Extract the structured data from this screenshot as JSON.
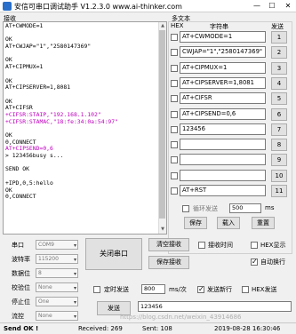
{
  "window": {
    "title": "安信可串口调试助手 V1.2.3.0    www.ai-thinker.com",
    "minimize": "—",
    "maximize": "☐",
    "close": "✕"
  },
  "receive": {
    "label": "接收",
    "lines": [
      {
        "text": "AT+CWMODE=1",
        "style": ""
      },
      {
        "text": "",
        "style": ""
      },
      {
        "text": "OK",
        "style": ""
      },
      {
        "text": "AT+CWJAP=\"1\",\"2580147369\"",
        "style": ""
      },
      {
        "text": "",
        "style": ""
      },
      {
        "text": "OK",
        "style": ""
      },
      {
        "text": "AT+CIPMUX=1",
        "style": ""
      },
      {
        "text": "",
        "style": ""
      },
      {
        "text": "OK",
        "style": ""
      },
      {
        "text": "AT+CIPSERVER=1,8081",
        "style": ""
      },
      {
        "text": "",
        "style": ""
      },
      {
        "text": "OK",
        "style": ""
      },
      {
        "text": "AT+CIFSR",
        "style": ""
      },
      {
        "text": "+CIFSR:STAIP,\"192.168.1.102\"",
        "style": "pink"
      },
      {
        "text": "+CIFSR:STAMAC,\"18:fe:34:0a:54:97\"",
        "style": "pink"
      },
      {
        "text": "",
        "style": ""
      },
      {
        "text": "OK",
        "style": ""
      },
      {
        "text": "0,CONNECT",
        "style": ""
      },
      {
        "text": "AT+CIPSEND=0,6",
        "style": "pink"
      },
      {
        "text": "> 123456busy s...",
        "style": ""
      },
      {
        "text": "",
        "style": ""
      },
      {
        "text": "SEND OK",
        "style": ""
      },
      {
        "text": "",
        "style": ""
      },
      {
        "text": "+IPD,0,5:hello",
        "style": ""
      },
      {
        "text": "OK",
        "style": ""
      },
      {
        "text": "0,CONNECT",
        "style": ""
      }
    ]
  },
  "multi": {
    "label": "多文本",
    "hex_header": "HEX",
    "string_header": "字符串",
    "send_header": "发送",
    "rows": [
      {
        "checked": false,
        "text": "AT+CWMODE=1",
        "btn": "1"
      },
      {
        "checked": false,
        "text": "CWJAP=\"1\",\"2580147369\"",
        "btn": "2"
      },
      {
        "checked": false,
        "text": "AT+CIPMUX=1",
        "btn": "3"
      },
      {
        "checked": false,
        "text": "AT+CIPSERVER=1,8081",
        "btn": "4"
      },
      {
        "checked": false,
        "text": "AT+CIFSR",
        "btn": "5"
      },
      {
        "checked": false,
        "text": "AT+CIPSEND=0,6",
        "btn": "6"
      },
      {
        "checked": false,
        "text": "123456",
        "btn": "7"
      },
      {
        "checked": false,
        "text": "",
        "btn": "8"
      },
      {
        "checked": false,
        "text": "",
        "btn": "9"
      },
      {
        "checked": false,
        "text": "",
        "btn": "10"
      },
      {
        "checked": false,
        "text": "AT+RST",
        "btn": "11"
      }
    ],
    "loop_label": "循环发送",
    "loop_value": "500",
    "loop_unit": "ms",
    "save_btn": "保存",
    "load_btn": "载入",
    "reset_btn": "重置"
  },
  "serial": {
    "port_label": "串口",
    "port_value": "COM9",
    "baud_label": "波特率",
    "baud_value": "115200",
    "data_label": "数据位",
    "data_value": "8",
    "parity_label": "校验位",
    "parity_value": "None",
    "stop_label": "停止位",
    "stop_value": "One",
    "flow_label": "流控",
    "flow_value": "None",
    "close_port_btn": "关闭串口"
  },
  "options": {
    "clear_recv_btn": "清空接收",
    "save_recv_btn": "保存接收",
    "recv_time_label": "接收时间",
    "hex_display_label": "HEX显示",
    "auto_newline_label": "自动换行",
    "timed_send_label": "定时发送",
    "timed_value": "800",
    "timed_unit": "ms/次",
    "send_newline_label": "发送新行",
    "hex_send_label": "HEX发送",
    "send_btn": "发送",
    "send_value": "123456"
  },
  "watermark": "https://blog.csdn.net/weixin_43914686",
  "status": {
    "send_ok": "Send OK !",
    "received": "Received: 269",
    "sent": "Sent: 108",
    "datetime": "2019-08-28 16:30:46"
  }
}
